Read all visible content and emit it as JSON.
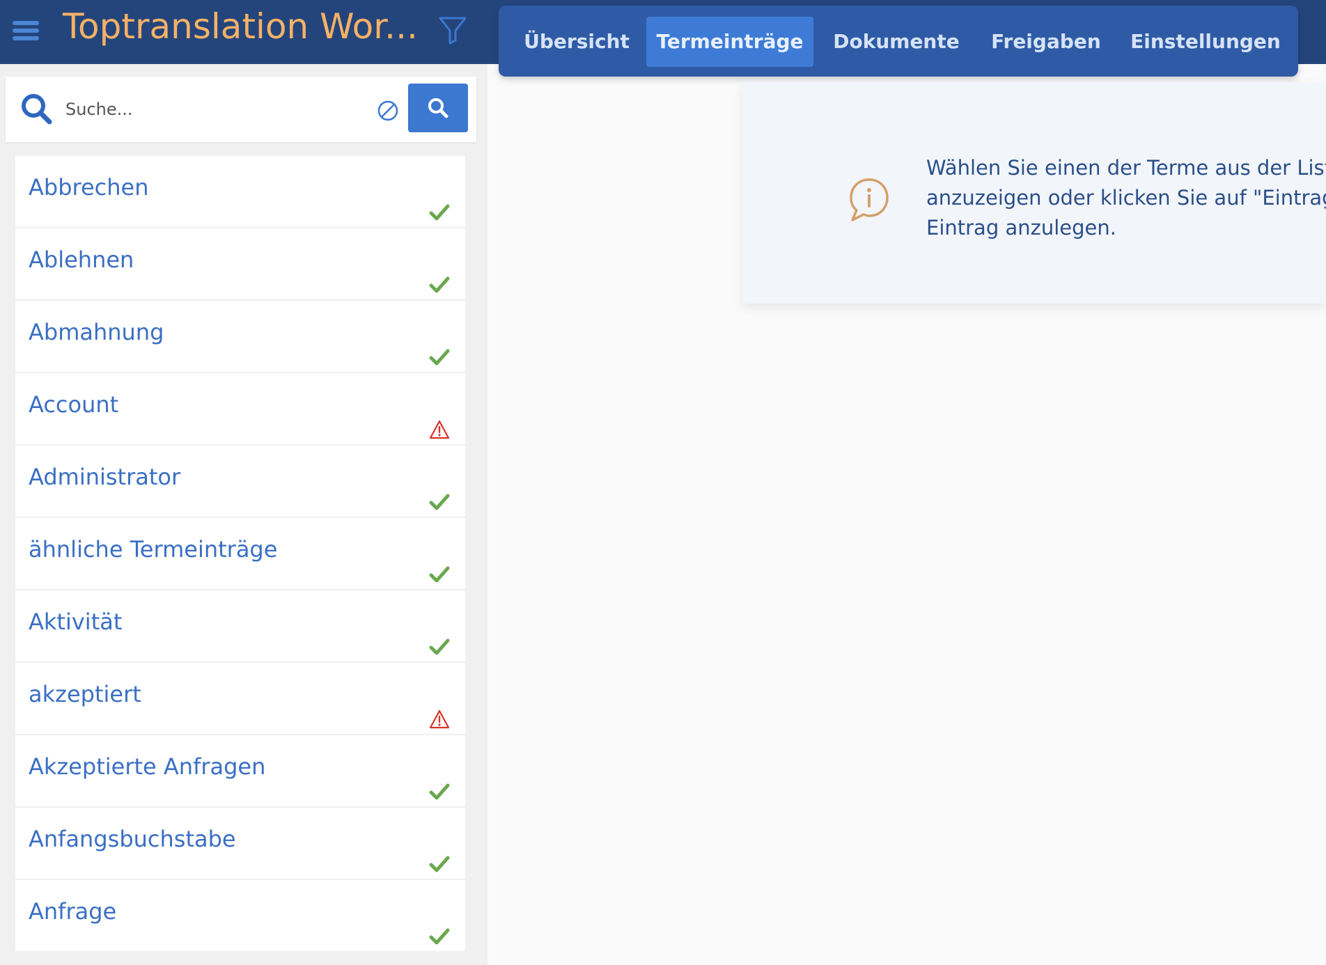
{
  "app": {
    "title": "Toptranslation Wor..."
  },
  "tabs": [
    {
      "label": "Übersicht",
      "active": false
    },
    {
      "label": "Termeinträge",
      "active": true
    },
    {
      "label": "Dokumente",
      "active": false
    },
    {
      "label": "Freigaben",
      "active": false
    },
    {
      "label": "Einstellungen",
      "active": false
    }
  ],
  "search": {
    "placeholder": "Suche...",
    "value": ""
  },
  "terms": [
    {
      "label": "Abbrechen",
      "status": "approved"
    },
    {
      "label": "Ablehnen",
      "status": "approved"
    },
    {
      "label": "Abmahnung",
      "status": "approved"
    },
    {
      "label": "Account",
      "status": "warning"
    },
    {
      "label": "Administrator",
      "status": "approved"
    },
    {
      "label": "ähnliche Termeinträge",
      "status": "approved"
    },
    {
      "label": "Aktivität",
      "status": "approved"
    },
    {
      "label": "akzeptiert",
      "status": "warning"
    },
    {
      "label": "Akzeptierte Anfragen",
      "status": "approved"
    },
    {
      "label": "Anfangsbuchstabe",
      "status": "approved"
    },
    {
      "label": "Anfrage",
      "status": "approved"
    }
  ],
  "info": {
    "line1": "Wählen Sie einen der Terme aus der List",
    "line2": "anzuzeigen oder klicken Sie auf \"Eintrag",
    "line3": "Eintrag anzulegen."
  },
  "colors": {
    "header": "#24457c",
    "tabbar": "#2f5ba6",
    "tab_active": "#3d7bd6",
    "title": "#f6b166",
    "link": "#3a6fc4",
    "approved": "#6aa84f",
    "warning": "#d9322a"
  },
  "icons": {
    "menu": "hamburger-icon",
    "filter": "filter-icon",
    "search": "search-icon",
    "clear": "clear-search-icon",
    "approved": "checkmark-icon",
    "warning": "warning-icon",
    "info": "info-speech-bubble-icon"
  }
}
